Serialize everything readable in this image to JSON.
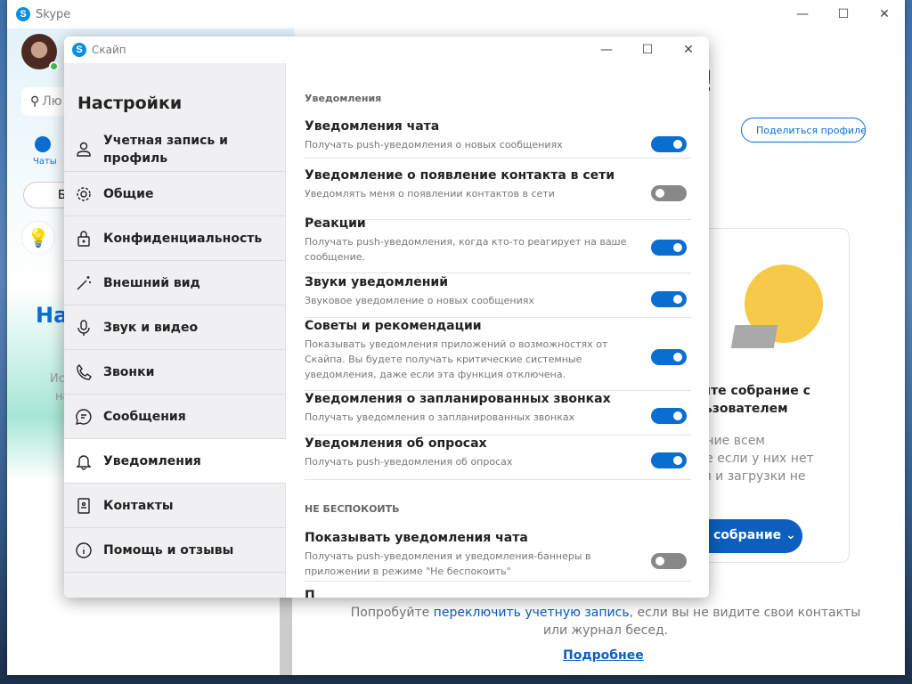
{
  "main_window": {
    "title": "Skype",
    "minimize": "—",
    "maximize": "☐",
    "close": "✕"
  },
  "left_pane": {
    "search_placeholder": "Лю",
    "chats_label": "Чаты",
    "meet_label": "Б",
    "heading_partial": "На",
    "text_partial_1": "Ис",
    "text_partial_2": "на"
  },
  "background": {
    "greeting_partial": "ь!",
    "share_profile": "Поделиться профиле",
    "card_title": "зуйте собрание с\nользователем",
    "card_text": "шение всем\nаже если у них нет\nции и загрузки не",
    "card_button": "ое собрание",
    "hint_before": "Попробуйте ",
    "hint_link": "переключить учетную запись",
    "hint_after": ", если вы не видите свои контакты или журнал бесед.",
    "more_link": "Подробнее"
  },
  "dialog": {
    "title": "Скайп",
    "minimize": "—",
    "maximize": "☐",
    "close": "✕"
  },
  "nav": {
    "heading": "Настройки",
    "items": [
      {
        "label": "Учетная запись и профиль",
        "icon": "person-icon"
      },
      {
        "label": "Общие",
        "icon": "gear-icon"
      },
      {
        "label": "Конфиденциальность",
        "icon": "lock-icon"
      },
      {
        "label": "Внешний вид",
        "icon": "magic-wand-icon"
      },
      {
        "label": "Звук и видео",
        "icon": "microphone-icon"
      },
      {
        "label": "Звонки",
        "icon": "phone-icon"
      },
      {
        "label": "Сообщения",
        "icon": "chat-icon"
      },
      {
        "label": "Уведомления",
        "icon": "bell-icon",
        "active": true
      },
      {
        "label": "Контакты",
        "icon": "contacts-book-icon"
      },
      {
        "label": "Помощь и отзывы",
        "icon": "info-icon"
      }
    ]
  },
  "notifications": {
    "section": "Уведомления",
    "rows": [
      {
        "title": "Уведомления чата",
        "sub": "Получать push-уведомления о новых сообщениях",
        "on": true
      },
      {
        "title": "Уведомление о появление контакта в сети",
        "sub": "Уведомлять меня о появлении контактов в сети",
        "on": false
      },
      {
        "title": "Реакции",
        "sub": "Получать push-уведомления, когда кто-то реагирует на ваше сообщение.",
        "on": true
      },
      {
        "title": "Звуки уведомлений",
        "sub": "Звуковое уведомление о новых сообщениях",
        "on": true
      },
      {
        "title": "Советы и рекомендации",
        "sub": "Показывать уведомления приложений о возможностях от Скайпа. Вы будете получать критические системные уведомления, даже если эта функция отключена.",
        "on": true
      },
      {
        "title": "Уведомления о запланированных звонках",
        "sub": "Получать уведомления о запланированных звонках",
        "on": true
      },
      {
        "title": "Уведомления об опросах",
        "sub": "Получать push-уведомления об опросах",
        "on": true
      }
    ],
    "dnd_section": "НЕ БЕСПОКОИТЬ",
    "dnd_rows": [
      {
        "title": "Показывать уведомления чата",
        "sub": "Получать push-уведомления и уведомления-баннеры в приложении в режиме \"Не беспокоить\"",
        "on": false
      }
    ]
  },
  "colors": {
    "accent": "#0a6ed1",
    "toggle_off": "#888888",
    "nav_bg": "#f0f0f2"
  }
}
